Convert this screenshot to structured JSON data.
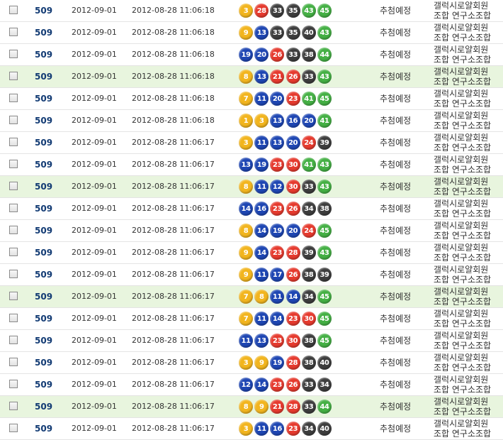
{
  "colors": {
    "yellow": "#f2b51e",
    "red": "#e63a2e",
    "blue": "#1e46b3",
    "dark": "#3d3d3d",
    "green": "#44b044",
    "highlight_row": "#e8f5de"
  },
  "rows": [
    {
      "round": "509",
      "draw_date": "2012-09-01",
      "reg_time": "2012-08-28 11:06:18",
      "numbers": [
        "3",
        "28",
        "33",
        "35",
        "43",
        "45"
      ],
      "status": "추첨예정",
      "shop_line1": "갤럭시로얄회원",
      "shop_line2": "조합 연구소조합",
      "highlight": false
    },
    {
      "round": "509",
      "draw_date": "2012-09-01",
      "reg_time": "2012-08-28 11:06:18",
      "numbers": [
        "9",
        "13",
        "33",
        "35",
        "40",
        "43"
      ],
      "status": "추첨예정",
      "shop_line1": "갤럭시로얄회원",
      "shop_line2": "조합 연구소조합",
      "highlight": false
    },
    {
      "round": "509",
      "draw_date": "2012-09-01",
      "reg_time": "2012-08-28 11:06:18",
      "numbers": [
        "19",
        "20",
        "26",
        "33",
        "38",
        "44"
      ],
      "status": "추첨예정",
      "shop_line1": "갤럭시로얄회원",
      "shop_line2": "조합 연구소조합",
      "highlight": false
    },
    {
      "round": "509",
      "draw_date": "2012-09-01",
      "reg_time": "2012-08-28 11:06:18",
      "numbers": [
        "8",
        "13",
        "21",
        "26",
        "33",
        "43"
      ],
      "status": "추첨예정",
      "shop_line1": "갤럭시로얄회원",
      "shop_line2": "조합 연구소조합",
      "highlight": true
    },
    {
      "round": "509",
      "draw_date": "2012-09-01",
      "reg_time": "2012-08-28 11:06:18",
      "numbers": [
        "7",
        "11",
        "20",
        "23",
        "41",
        "45"
      ],
      "status": "추첨예정",
      "shop_line1": "갤럭시로얄회원",
      "shop_line2": "조합 연구소조합",
      "highlight": false
    },
    {
      "round": "509",
      "draw_date": "2012-09-01",
      "reg_time": "2012-08-28 11:06:18",
      "numbers": [
        "1",
        "3",
        "13",
        "16",
        "20",
        "41"
      ],
      "status": "추첨예정",
      "shop_line1": "갤럭시로얄회원",
      "shop_line2": "조합 연구소조합",
      "highlight": false
    },
    {
      "round": "509",
      "draw_date": "2012-09-01",
      "reg_time": "2012-08-28 11:06:17",
      "numbers": [
        "3",
        "11",
        "13",
        "20",
        "24",
        "39"
      ],
      "status": "추첨예정",
      "shop_line1": "갤럭시로얄회원",
      "shop_line2": "조합 연구소조합",
      "highlight": false
    },
    {
      "round": "509",
      "draw_date": "2012-09-01",
      "reg_time": "2012-08-28 11:06:17",
      "numbers": [
        "13",
        "19",
        "23",
        "30",
        "41",
        "43"
      ],
      "status": "추첨예정",
      "shop_line1": "갤럭시로얄회원",
      "shop_line2": "조합 연구소조합",
      "highlight": false
    },
    {
      "round": "509",
      "draw_date": "2012-09-01",
      "reg_time": "2012-08-28 11:06:17",
      "numbers": [
        "8",
        "11",
        "12",
        "30",
        "33",
        "43"
      ],
      "status": "추첨예정",
      "shop_line1": "갤럭시로얄회원",
      "shop_line2": "조합 연구소조합",
      "highlight": true
    },
    {
      "round": "509",
      "draw_date": "2012-09-01",
      "reg_time": "2012-08-28 11:06:17",
      "numbers": [
        "14",
        "16",
        "23",
        "26",
        "34",
        "38"
      ],
      "status": "추첨예정",
      "shop_line1": "갤럭시로얄회원",
      "shop_line2": "조합 연구소조합",
      "highlight": false
    },
    {
      "round": "509",
      "draw_date": "2012-09-01",
      "reg_time": "2012-08-28 11:06:17",
      "numbers": [
        "8",
        "14",
        "19",
        "20",
        "24",
        "45"
      ],
      "status": "추첨예정",
      "shop_line1": "갤럭시로얄회원",
      "shop_line2": "조합 연구소조합",
      "highlight": false
    },
    {
      "round": "509",
      "draw_date": "2012-09-01",
      "reg_time": "2012-08-28 11:06:17",
      "numbers": [
        "9",
        "14",
        "23",
        "28",
        "39",
        "43"
      ],
      "status": "추첨예정",
      "shop_line1": "갤럭시로얄회원",
      "shop_line2": "조합 연구소조합",
      "highlight": false
    },
    {
      "round": "509",
      "draw_date": "2012-09-01",
      "reg_time": "2012-08-28 11:06:17",
      "numbers": [
        "9",
        "11",
        "17",
        "26",
        "38",
        "39"
      ],
      "status": "추첨예정",
      "shop_line1": "갤럭시로얄회원",
      "shop_line2": "조합 연구소조합",
      "highlight": false
    },
    {
      "round": "509",
      "draw_date": "2012-09-01",
      "reg_time": "2012-08-28 11:06:17",
      "numbers": [
        "7",
        "8",
        "11",
        "14",
        "34",
        "45"
      ],
      "status": "추첨예정",
      "shop_line1": "갤럭시로얄회원",
      "shop_line2": "조합 연구소조합",
      "highlight": true
    },
    {
      "round": "509",
      "draw_date": "2012-09-01",
      "reg_time": "2012-08-28 11:06:17",
      "numbers": [
        "7",
        "11",
        "14",
        "23",
        "30",
        "45"
      ],
      "status": "추첨예정",
      "shop_line1": "갤럭시로얄회원",
      "shop_line2": "조합 연구소조합",
      "highlight": false
    },
    {
      "round": "509",
      "draw_date": "2012-09-01",
      "reg_time": "2012-08-28 11:06:17",
      "numbers": [
        "11",
        "13",
        "23",
        "30",
        "38",
        "45"
      ],
      "status": "추첨예정",
      "shop_line1": "갤럭시로얄회원",
      "shop_line2": "조합 연구소조합",
      "highlight": false
    },
    {
      "round": "509",
      "draw_date": "2012-09-01",
      "reg_time": "2012-08-28 11:06:17",
      "numbers": [
        "3",
        "9",
        "19",
        "28",
        "38",
        "40"
      ],
      "status": "추첨예정",
      "shop_line1": "갤럭시로얄회원",
      "shop_line2": "조합 연구소조합",
      "highlight": false
    },
    {
      "round": "509",
      "draw_date": "2012-09-01",
      "reg_time": "2012-08-28 11:06:17",
      "numbers": [
        "12",
        "14",
        "23",
        "26",
        "33",
        "34"
      ],
      "status": "추첨예정",
      "shop_line1": "갤럭시로얄회원",
      "shop_line2": "조합 연구소조합",
      "highlight": false
    },
    {
      "round": "509",
      "draw_date": "2012-09-01",
      "reg_time": "2012-08-28 11:06:17",
      "numbers": [
        "8",
        "9",
        "21",
        "28",
        "33",
        "44"
      ],
      "status": "추첨예정",
      "shop_line1": "갤럭시로얄회원",
      "shop_line2": "조합 연구소조합",
      "highlight": true
    },
    {
      "round": "509",
      "draw_date": "2012-09-01",
      "reg_time": "2012-08-28 11:06:17",
      "numbers": [
        "3",
        "11",
        "16",
        "23",
        "34",
        "40"
      ],
      "status": "추첨예정",
      "shop_line1": "갤럭시로얄회원",
      "shop_line2": "조합 연구소조합",
      "highlight": false
    }
  ]
}
